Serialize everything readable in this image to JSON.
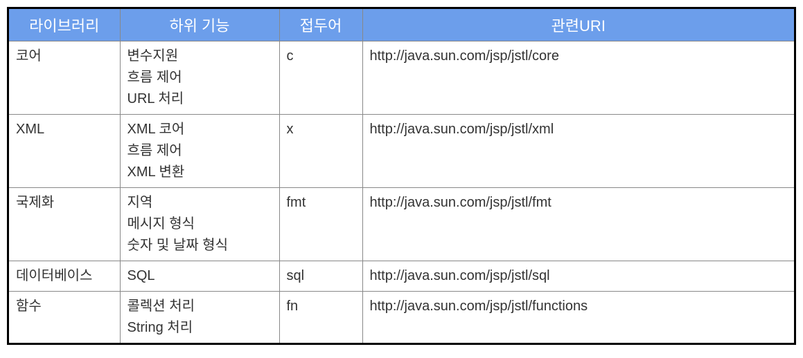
{
  "headers": {
    "library": "라이브러리",
    "subfunction": "하위 기능",
    "prefix": "접두어",
    "uri": "관련URI"
  },
  "rows": [
    {
      "library": "코어",
      "subfunction": "변수지원\n흐름 제어\nURL 처리",
      "prefix": "c",
      "uri": "http://java.sun.com/jsp/jstl/core"
    },
    {
      "library": "XML",
      "subfunction": "XML 코어\n흐름 제어\nXML 변환",
      "prefix": "x",
      "uri": "http://java.sun.com/jsp/jstl/xml"
    },
    {
      "library": "국제화",
      "subfunction": "지역\n메시지 형식\n숫자 및 날짜 형식",
      "prefix": "fmt",
      "uri": "http://java.sun.com/jsp/jstl/fmt"
    },
    {
      "library": "데이터베이스",
      "subfunction": "SQL",
      "prefix": "sql",
      "uri": "http://java.sun.com/jsp/jstl/sql"
    },
    {
      "library": "함수",
      "subfunction": "콜렉션 처리\nString 처리",
      "prefix": "fn",
      "uri": "http://java.sun.com/jsp/jstl/functions"
    }
  ]
}
